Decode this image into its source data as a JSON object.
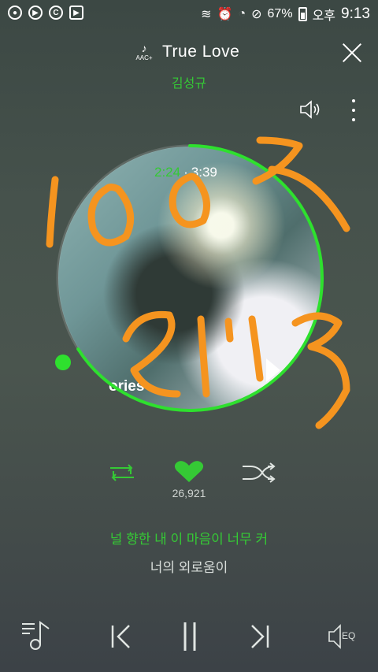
{
  "status_bar": {
    "battery_percent": "67%",
    "ampm": "오후",
    "time": "9:13",
    "left_icons": [
      "record-icon",
      "play-circle-icon",
      "copyright-icon",
      "video-icon"
    ],
    "right_icons": [
      "vibrate-icon",
      "alarm-icon",
      "wifi-icon",
      "block-icon",
      "battery-icon"
    ]
  },
  "header": {
    "codec_label": "AAC+",
    "song_title": "True Love",
    "artist": "김성규"
  },
  "player": {
    "current_time": "2:24",
    "separator": "·",
    "total_time": "3:39",
    "album_text": "ories",
    "progress_fraction": 0.66
  },
  "actions": {
    "like_count": "26,921"
  },
  "lyrics": {
    "current_line": "널 향한 내 이 마음이 너무 커",
    "next_line": "너의 외로움이"
  },
  "bottom_bar": {
    "eq_label": "EQ"
  },
  "handwriting": {
    "line1": "1002",
    "line2": "2113",
    "color": "#f5941f"
  },
  "colors": {
    "accent": "#35c935",
    "progress": "#2ee02e"
  }
}
